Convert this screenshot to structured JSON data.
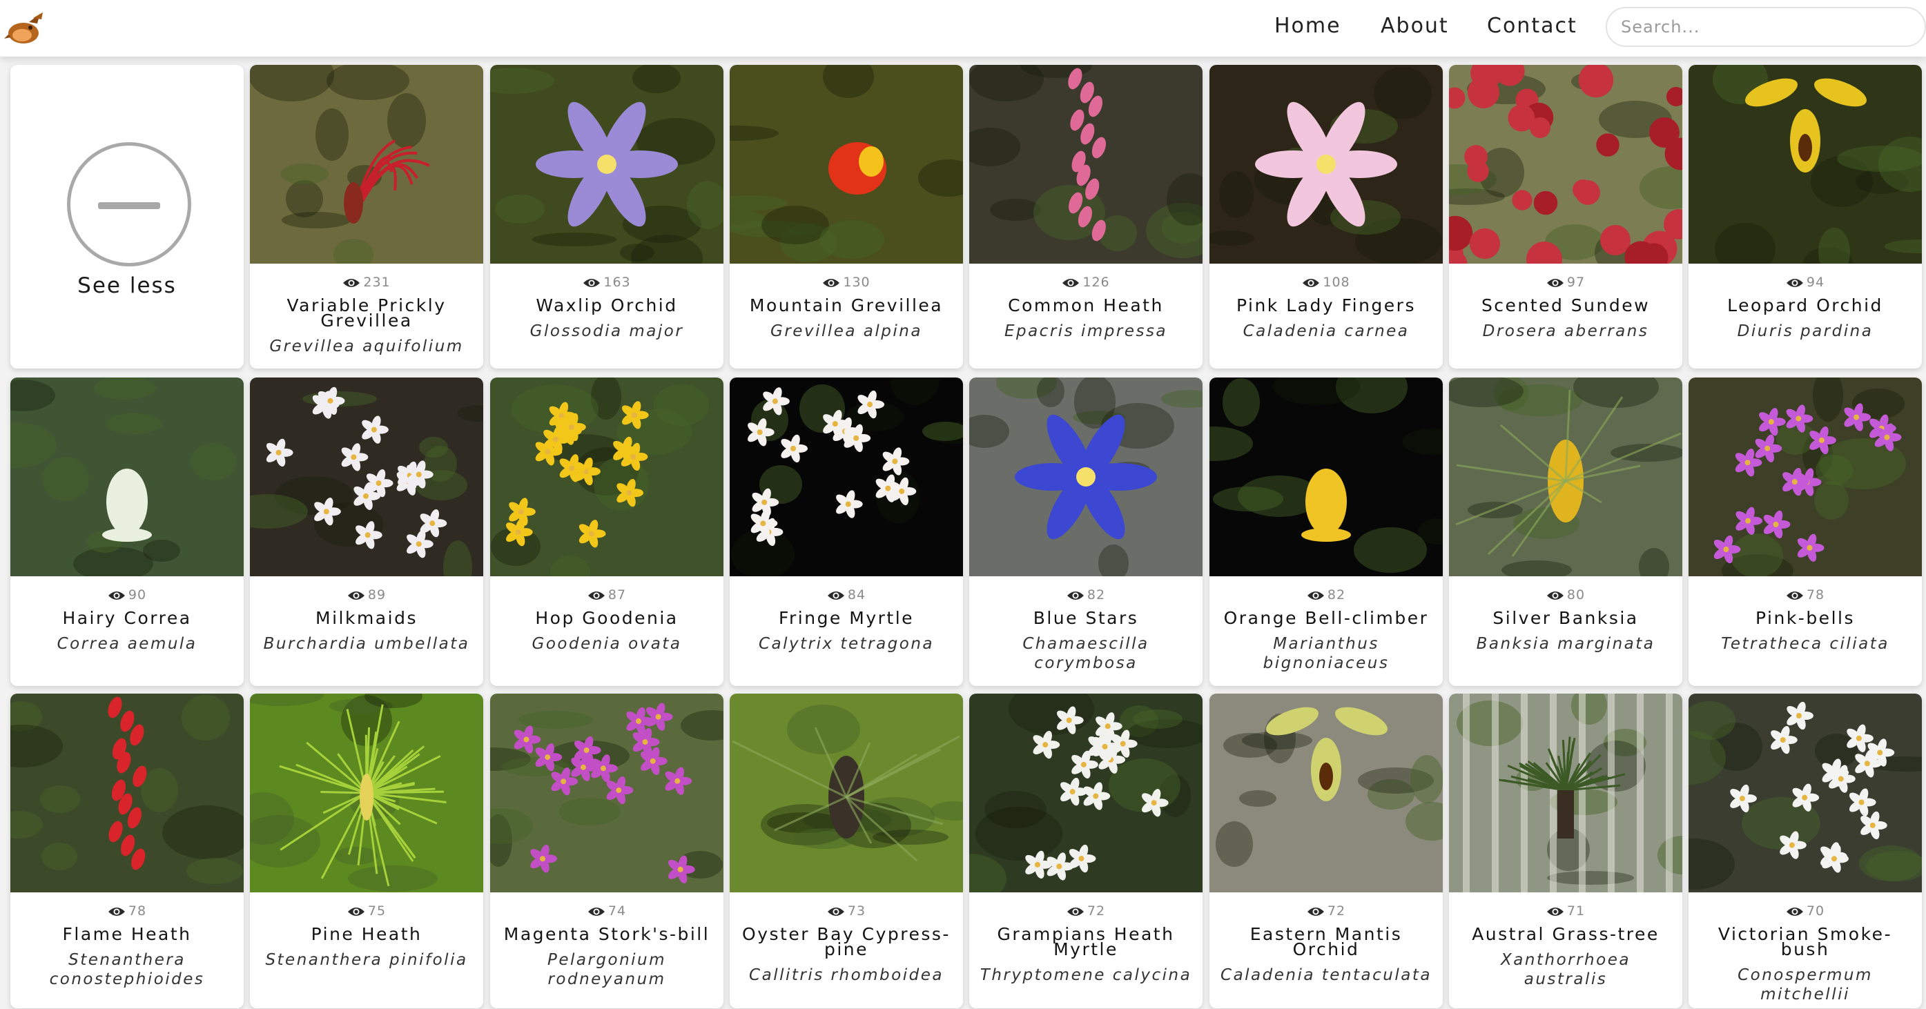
{
  "header": {
    "logo_icon": "platypus-logo-icon",
    "nav": [
      "Home",
      "About",
      "Contact"
    ],
    "search_placeholder": "Search..."
  },
  "see_less": {
    "label": "See less",
    "icon": "minus-circle-icon"
  },
  "eye_icon": "eye-icon",
  "species": [
    {
      "common": "Variable Prickly Grevillea",
      "scientific": "Grevillea aquifolium",
      "views": "231",
      "bg": "#6d6a3d",
      "flower": "#c8202a",
      "kind": "spider"
    },
    {
      "common": "Waxlip Orchid",
      "scientific": "Glossodia major",
      "views": "163",
      "bg": "#3f4a1e",
      "flower": "#9b8ad6",
      "kind": "star"
    },
    {
      "common": "Mountain Grevillea",
      "scientific": "Grevillea alpina",
      "views": "130",
      "bg": "#4a4f1d",
      "flower": "#e23318",
      "kind": "cup"
    },
    {
      "common": "Common Heath",
      "scientific": "Epacris impressa",
      "views": "126",
      "bg": "#3b3a2c",
      "flower": "#e06a97",
      "kind": "spike"
    },
    {
      "common": "Pink Lady Fingers",
      "scientific": "Caladenia carnea",
      "views": "108",
      "bg": "#2d2517",
      "flower": "#f2c6dd",
      "kind": "star"
    },
    {
      "common": "Scented Sundew",
      "scientific": "Drosera aberrans",
      "views": "97",
      "bg": "#7c7d52",
      "flower": "#c6323d",
      "kind": "rosette"
    },
    {
      "common": "Leopard Orchid",
      "scientific": "Diuris pardina",
      "views": "94",
      "bg": "#2e3617",
      "flower": "#e6c31f",
      "kind": "orchid"
    },
    {
      "common": "Hairy Correa",
      "scientific": "Correa aemula",
      "views": "90",
      "bg": "#3f5534",
      "flower": "#e9f0df",
      "kind": "bell"
    },
    {
      "common": "Milkmaids",
      "scientific": "Burchardia umbellata",
      "views": "89",
      "bg": "#2f2b22",
      "flower": "#f1eef1",
      "kind": "cluster"
    },
    {
      "common": "Hop Goodenia",
      "scientific": "Goodenia ovata",
      "views": "87",
      "bg": "#3f5229",
      "flower": "#f2c719",
      "kind": "cluster"
    },
    {
      "common": "Fringe Myrtle",
      "scientific": "Calytrix tetragona",
      "views": "84",
      "bg": "#060606",
      "flower": "#f4f1ee",
      "kind": "cluster"
    },
    {
      "common": "Blue Stars",
      "scientific": "Chamaescilla corymbosa",
      "views": "82",
      "bg": "#6b6d68",
      "flower": "#3c48d1",
      "kind": "star"
    },
    {
      "common": "Orange Bell-climber",
      "scientific": "Marianthus bignoniaceus",
      "views": "82",
      "bg": "#070707",
      "flower": "#f1c426",
      "kind": "bell"
    },
    {
      "common": "Silver Banksia",
      "scientific": "Banksia marginata",
      "views": "80",
      "bg": "#5f6a4f",
      "flower": "#e0b41e",
      "kind": "cone"
    },
    {
      "common": "Pink-bells",
      "scientific": "Tetratheca ciliata",
      "views": "78",
      "bg": "#3d4026",
      "flower": "#c45ad7",
      "kind": "cluster"
    },
    {
      "common": "Flame Heath",
      "scientific": "Stenanthera conostephioides",
      "views": "78",
      "bg": "#3d4a2a",
      "flower": "#d8242a",
      "kind": "spike"
    },
    {
      "common": "Pine Heath",
      "scientific": "Stenanthera pinifolia",
      "views": "75",
      "bg": "#5d8a20",
      "flower": "#e4d25a",
      "kind": "needle"
    },
    {
      "common": "Magenta Stork's-bill",
      "scientific": "Pelargonium rodneyanum",
      "views": "74",
      "bg": "#5a6a3c",
      "flower": "#c34fc6",
      "kind": "cluster"
    },
    {
      "common": "Oyster Bay Cypress-pine",
      "scientific": "Callitris rhomboidea",
      "views": "73",
      "bg": "#6b8a2e",
      "flower": "#3a3228",
      "kind": "cone"
    },
    {
      "common": "Grampians Heath Myrtle",
      "scientific": "Thryptomene calycina",
      "views": "72",
      "bg": "#2e3b22",
      "flower": "#f1f1ee",
      "kind": "cluster"
    },
    {
      "common": "Eastern Mantis Orchid",
      "scientific": "Caladenia tentaculata",
      "views": "72",
      "bg": "#8c8a7c",
      "flower": "#cfd26e",
      "kind": "orchid"
    },
    {
      "common": "Austral Grass-tree",
      "scientific": "Xanthorrhoea australis",
      "views": "71",
      "bg": "#8f9683",
      "flower": "#3c5a26",
      "kind": "grasstree"
    },
    {
      "common": "Victorian Smoke-bush",
      "scientific": "Conospermum mitchellii",
      "views": "70",
      "bg": "#3a3d30",
      "flower": "#f3f3f1",
      "kind": "cluster"
    }
  ]
}
